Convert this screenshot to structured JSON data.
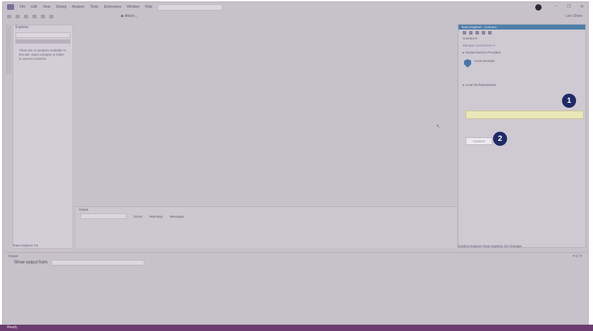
{
  "menubar": {
    "items": [
      "File",
      "Edit",
      "View",
      "Debug",
      "Analyze",
      "Tools",
      "Extensions",
      "Window",
      "Help"
    ],
    "search_placeholder": "",
    "window_controls": [
      "–",
      "❐",
      "✕"
    ],
    "live_share": "Live Share"
  },
  "toolbar": {
    "attach_label": "▶ Attach..."
  },
  "left_panel": {
    "header": "Explorer",
    "message": "There are no projects available in this tab. Open a project or folder to view its contents."
  },
  "output_panel": {
    "header": "Output",
    "filters": [
      "Errors",
      "Warnings",
      "Messages"
    ]
  },
  "left_bottom_tabs": "Team Explorer  Git",
  "right_panel": {
    "title": "Team Explorer - Connect",
    "connect_header": "Connect ▾",
    "manage": "Manage Connections ▾",
    "hosted_header": "▸ Hosted Service Providers",
    "service_name": "Azure DevOps",
    "service_sub": "",
    "service_desc": "",
    "local_header": "▸ Local Git Repositories",
    "highlight_text": "",
    "local_option": "",
    "connect_button": "Connect"
  },
  "right_footer": "Solution Explorer  Team Explorer  Git Changes",
  "callouts": [
    "1",
    "2"
  ],
  "lower_panel": {
    "header": "Output",
    "show_output_from": "Show output from:"
  },
  "statusbar": {
    "left": "Ready",
    "right": ""
  }
}
